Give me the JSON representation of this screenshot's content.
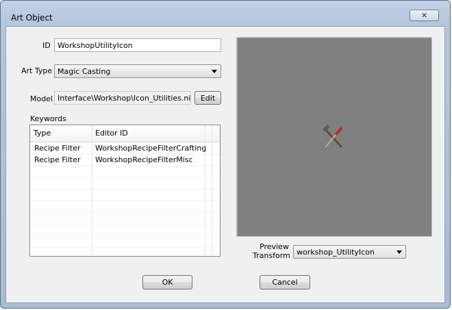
{
  "window": {
    "title": "Art Object",
    "close_icon": "close-icon"
  },
  "form": {
    "id_label": "ID",
    "id_value": "WorkshopUtilityIcon",
    "art_type_label": "Art Type",
    "art_type_value": "Magic Casting",
    "model_label": "Model",
    "model_value": "Interface\\Workshop\\Icon_Utilities.nif",
    "edit_button": "Edit",
    "keywords_label": "Keywords"
  },
  "keywords": {
    "columns": [
      "Type",
      "Editor ID"
    ],
    "rows": [
      {
        "type": "Recipe Filter",
        "editor_id": "WorkshopRecipeFilterCrafting"
      },
      {
        "type": "Recipe Filter",
        "editor_id": "WorkshopRecipeFilterMisc"
      }
    ]
  },
  "preview": {
    "transform_label_line1": "Preview",
    "transform_label_line2": "Transform",
    "transform_value": "workshop_UtilityIcon",
    "background_color": "#808080"
  },
  "footer": {
    "ok_button": "OK",
    "cancel_button": "Cancel"
  }
}
